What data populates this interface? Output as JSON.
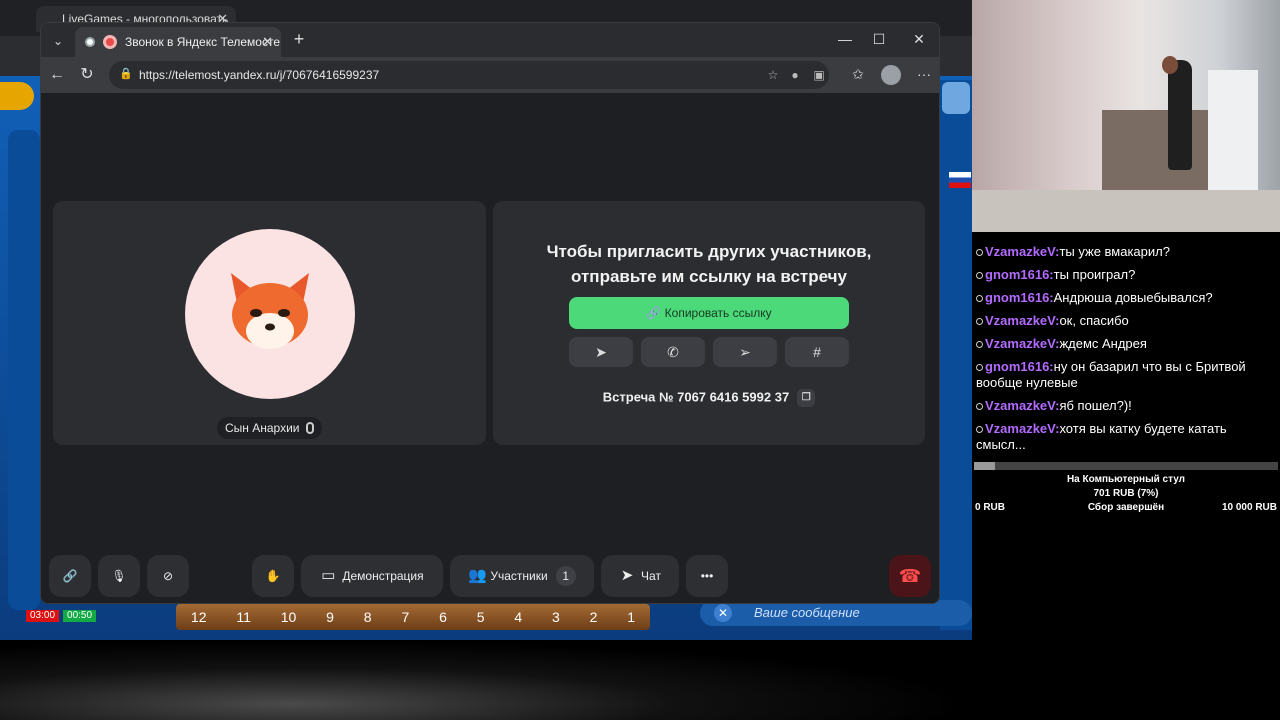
{
  "background_window": {
    "tab_title": "LiveGames - многопользовать",
    "timer_1": "03:00",
    "timer_2": "00:50",
    "board_numbers": [
      "12",
      "11",
      "10",
      "9",
      "8",
      "7",
      "6",
      "5",
      "4",
      "3",
      "2",
      "1"
    ],
    "message_placeholder": "Ваше сообщение"
  },
  "browser": {
    "tab_title": "Звонок в Яндекс Телемосте",
    "url": "https://telemost.yandex.ru/j/70676416599237"
  },
  "call": {
    "participant_name": "Сын Анархии",
    "invite_text_line1": "Чтобы пригласить других участников,",
    "invite_text_line2": "отправьте им ссылку на встречу",
    "copy_link_label": "Копировать ссылку",
    "meeting_number": "Встреча № 7067 6416 5992 37",
    "share_targets": [
      "telegram",
      "whatsapp",
      "send",
      "slack"
    ]
  },
  "toolbar": {
    "demo_label": "Демонстрация",
    "participants_label": "Участники",
    "participants_count": "1",
    "chat_label": "Чат"
  },
  "stream_chat": [
    {
      "user": "VzamazkeV:",
      "text": "ты уже вмакарил?"
    },
    {
      "user": "gnom1616:",
      "text": "ты проиграл?"
    },
    {
      "user": "gnom1616:",
      "text": "Андрюша довыебывался?"
    },
    {
      "user": "VzamazkeV:",
      "text": "ок, спасибо"
    },
    {
      "user": "VzamazkeV:",
      "text": "ждемс Андрея"
    },
    {
      "user": "gnom1616:",
      "text": "ну он базарил что вы с Бритвой вообще нулевые"
    },
    {
      "user": "VzamazkeV:",
      "text": "яб пошел?)!"
    },
    {
      "user": "VzamazkeV:",
      "text": "хотя вы катку будете катать смысл..."
    }
  ],
  "fundraiser": {
    "title": "На Компьютерный стул",
    "amount": "701 RUB (7%)",
    "progress": 0.07,
    "min": "0 RUB",
    "status": "Сбор завершён",
    "max": "10 000 RUB"
  },
  "colors": {
    "accent_green": "#4cd97a",
    "hangup_red": "#ff4c4c",
    "chat_user": "#b36bff"
  }
}
